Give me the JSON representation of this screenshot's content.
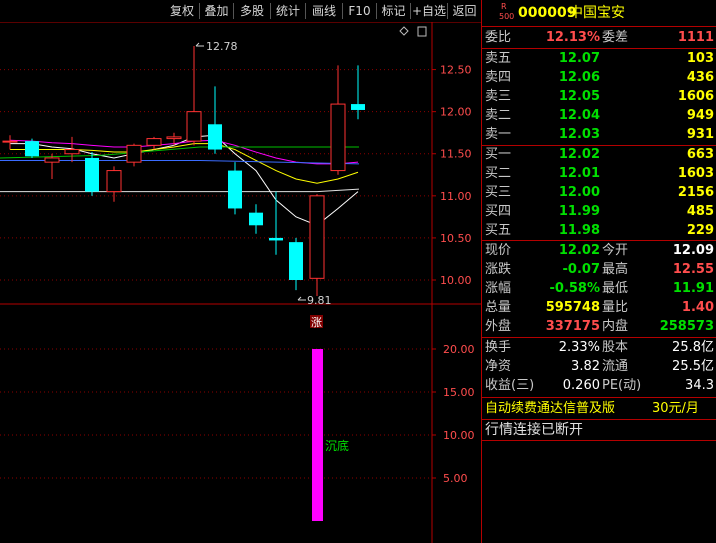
{
  "toolbar": {
    "buttons": [
      "复权",
      "叠加",
      "多股",
      "统计",
      "画线",
      "F10",
      "标记",
      "+自选",
      "返回"
    ]
  },
  "chart": {
    "price_ticks": [
      "12.50",
      "12.00",
      "11.50",
      "11.00",
      "10.50",
      "10.00"
    ],
    "indicator_ticks": [
      "20.00",
      "15.00",
      "10.00",
      "5.00"
    ],
    "high_label": "12.78",
    "low_label": "9.81",
    "zhang_marker": "涨",
    "indicator_label": "沉底",
    "icons": [
      "diamond-icon",
      "scroll-icon"
    ]
  },
  "chart_data": {
    "type": "candlestick",
    "ylim": [
      9.8,
      12.8
    ],
    "candles": [
      {
        "o": 11.65,
        "h": 11.72,
        "l": 11.55,
        "c": 11.65
      },
      {
        "o": 11.65,
        "h": 11.68,
        "l": 11.45,
        "c": 11.47
      },
      {
        "o": 11.4,
        "h": 11.5,
        "l": 11.2,
        "c": 11.45
      },
      {
        "o": 11.5,
        "h": 11.7,
        "l": 11.4,
        "c": 11.55
      },
      {
        "o": 11.45,
        "h": 11.52,
        "l": 11.0,
        "c": 11.05
      },
      {
        "o": 11.05,
        "h": 11.35,
        "l": 10.93,
        "c": 11.3
      },
      {
        "o": 11.4,
        "h": 11.62,
        "l": 11.35,
        "c": 11.6
      },
      {
        "o": 11.6,
        "h": 11.7,
        "l": 11.55,
        "c": 11.68
      },
      {
        "o": 11.68,
        "h": 11.75,
        "l": 11.6,
        "c": 11.7
      },
      {
        "o": 11.65,
        "h": 12.78,
        "l": 11.6,
        "c": 12.0
      },
      {
        "o": 11.85,
        "h": 12.3,
        "l": 11.5,
        "c": 11.55
      },
      {
        "o": 11.3,
        "h": 11.4,
        "l": 10.78,
        "c": 10.85
      },
      {
        "o": 10.8,
        "h": 10.9,
        "l": 10.55,
        "c": 10.65
      },
      {
        "o": 10.5,
        "h": 11.05,
        "l": 10.3,
        "c": 10.47
      },
      {
        "o": 10.45,
        "h": 10.5,
        "l": 9.88,
        "c": 10.0
      },
      {
        "o": 10.02,
        "h": 11.02,
        "l": 9.81,
        "c": 11.0
      },
      {
        "o": 11.3,
        "h": 12.55,
        "l": 11.25,
        "c": 12.09
      },
      {
        "o": 12.09,
        "h": 12.55,
        "l": 11.91,
        "c": 12.02
      }
    ],
    "indicator": {
      "name": "沉底",
      "value": 20.0,
      "ylim": [
        0,
        21
      ]
    },
    "colors": {
      "up": "#ff3232",
      "down": "#00ffff",
      "ind": "#ff00ff"
    }
  },
  "quote": {
    "code_prefix_top": "R",
    "code_prefix_bottom": "500",
    "code": "000009",
    "name": "中国宝安",
    "weibi_label": "委比",
    "weibi_value": "12.13%",
    "weicha_label": "委差",
    "weicha_value": "1111",
    "sells": [
      {
        "label": "卖五",
        "price": "12.07",
        "vol": "103"
      },
      {
        "label": "卖四",
        "price": "12.06",
        "vol": "436"
      },
      {
        "label": "卖三",
        "price": "12.05",
        "vol": "1606"
      },
      {
        "label": "卖二",
        "price": "12.04",
        "vol": "949"
      },
      {
        "label": "卖一",
        "price": "12.03",
        "vol": "931"
      }
    ],
    "buys": [
      {
        "label": "买一",
        "price": "12.02",
        "vol": "663"
      },
      {
        "label": "买二",
        "price": "12.01",
        "vol": "1603"
      },
      {
        "label": "买三",
        "price": "12.00",
        "vol": "2156"
      },
      {
        "label": "买四",
        "price": "11.99",
        "vol": "485"
      },
      {
        "label": "买五",
        "price": "11.98",
        "vol": "229"
      }
    ],
    "stats": [
      {
        "l1": "现价",
        "v1": "12.02",
        "c1": "green",
        "l2": "今开",
        "v2": "12.09",
        "c2": "white"
      },
      {
        "l1": "涨跌",
        "v1": "-0.07",
        "c1": "green",
        "l2": "最高",
        "v2": "12.55",
        "c2": "red"
      },
      {
        "l1": "涨幅",
        "v1": "-0.58%",
        "c1": "green",
        "l2": "最低",
        "v2": "11.91",
        "c2": "green"
      },
      {
        "l1": "总量",
        "v1": "595748",
        "c1": "yellow",
        "l2": "量比",
        "v2": "1.40",
        "c2": "red"
      },
      {
        "l1": "外盘",
        "v1": "337175",
        "c1": "red",
        "l2": "内盘",
        "v2": "258573",
        "c2": "green"
      }
    ],
    "fin": [
      {
        "l1": "换手",
        "v1": "2.33%",
        "l2": "股本",
        "v2": "25.8亿"
      },
      {
        "l1": "净资",
        "v1": "3.82",
        "l2": "流通",
        "v2": "25.5亿"
      },
      {
        "l1": "收益(三)",
        "v1": "0.260",
        "l2": "PE(动)",
        "v2": "34.3"
      }
    ],
    "promo": "自动续费通达信普及版",
    "promo_price": "30元/月",
    "status": "行情连接已断开"
  }
}
